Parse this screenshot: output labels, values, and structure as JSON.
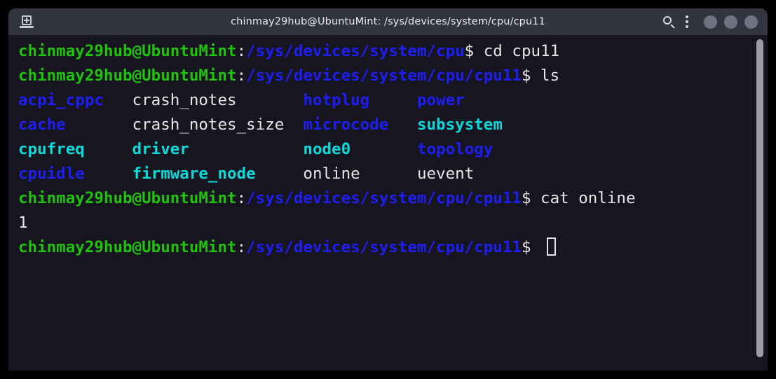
{
  "window": {
    "title": "chinmay29hub@UbuntuMint: /sys/devices/system/cpu/cpu11",
    "icons": {
      "new_tab": "new-tab-icon",
      "search": "search-icon",
      "menu": "kebab-menu-icon",
      "minimize": "minimize-button",
      "maximize": "maximize-button",
      "close": "close-button"
    }
  },
  "colors": {
    "titlebar_bg": "#32353f",
    "terminal_bg": "#17151f",
    "desktop_bg": "#000000",
    "green": "#20c20e",
    "blue": "#1e1ef0",
    "cyan": "#0fd8d8",
    "white": "#e6e6e6",
    "scrollbar": "#9b9ca5"
  },
  "terminal": {
    "prompt": {
      "userhost": "chinmay29hub@UbuntuMint",
      "colon": ":",
      "sigil": "$ "
    },
    "lines": [
      {
        "type": "prompt",
        "path": "/sys/devices/system/cpu",
        "command": "cd cpu11"
      },
      {
        "type": "prompt",
        "path": "/sys/devices/system/cpu/cpu11",
        "command": "ls"
      },
      {
        "type": "listing",
        "columns": [
          {
            "text": "acpi_cppc",
            "kind": "dir"
          },
          {
            "text": "crash_notes",
            "kind": "file"
          },
          {
            "text": "hotplug",
            "kind": "dir"
          },
          {
            "text": "power",
            "kind": "dir"
          }
        ]
      },
      {
        "type": "listing",
        "columns": [
          {
            "text": "cache",
            "kind": "dir"
          },
          {
            "text": "crash_notes_size",
            "kind": "file"
          },
          {
            "text": "microcode",
            "kind": "dir"
          },
          {
            "text": "subsystem",
            "kind": "link"
          }
        ]
      },
      {
        "type": "listing",
        "columns": [
          {
            "text": "cpufreq",
            "kind": "link"
          },
          {
            "text": "driver",
            "kind": "link"
          },
          {
            "text": "node0",
            "kind": "link"
          },
          {
            "text": "topology",
            "kind": "dir"
          }
        ]
      },
      {
        "type": "listing",
        "columns": [
          {
            "text": "cpuidle",
            "kind": "dir"
          },
          {
            "text": "firmware_node",
            "kind": "link"
          },
          {
            "text": "online",
            "kind": "file"
          },
          {
            "text": "uevent",
            "kind": "file"
          }
        ]
      },
      {
        "type": "prompt",
        "path": "/sys/devices/system/cpu/cpu11",
        "command": "cat online"
      },
      {
        "type": "output",
        "text": "1"
      },
      {
        "type": "prompt",
        "path": "/sys/devices/system/cpu/cpu11",
        "command": "",
        "cursor": true
      }
    ],
    "listing_column_starts": [
      0,
      12,
      30,
      42
    ]
  }
}
